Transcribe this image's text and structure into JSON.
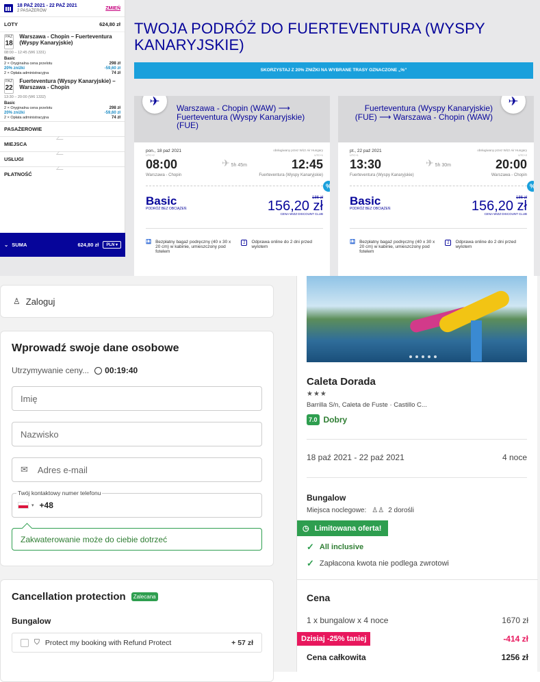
{
  "wizz": {
    "sidebar": {
      "dates": "18 PAŹ 2021 - 22 PAŹ 2021",
      "pax": "2 PASAŻERÓW",
      "change": "ZMIEŃ",
      "flights_label": "LOTY",
      "flights_total": "624,80 zł",
      "outbound": {
        "month": "PAŹ",
        "day": "18",
        "route": "Warszawa - Chopin – Fuerteventura (Wyspy Kanaryjskie)",
        "time": "08:00 – 12:45 (W6 1331)"
      },
      "outbound_fare": {
        "name": "Basic",
        "l1": "2 × Oryginalna cena przelotu",
        "v1": "298 zł",
        "l2": "20% zniżki",
        "v2": "-59,60 zł",
        "l3": "2 × Opłata administracyjna",
        "v3": "74 zł"
      },
      "inbound": {
        "month": "PAŹ",
        "day": "22",
        "route": "Fuerteventura (Wyspy Kanaryjskie) – Warszawa - Chopin",
        "time": "13:30 – 20:00 (W6 1332)"
      },
      "inbound_fare": {
        "name": "Basic",
        "l1": "2 × Oryginalna cena przelotu",
        "v1": "298 zł",
        "l2": "20% zniżki",
        "v2": "-59,60 zł",
        "l3": "2 × Opłata administracyjna",
        "v3": "74 zł"
      },
      "nav": [
        "PASAŻEROWIE",
        "MIEJSCA",
        "USŁUGI",
        "PŁATNOŚĆ"
      ],
      "sum_label": "SUMA",
      "sum_value": "624,80 zł",
      "currency": "PLN"
    },
    "title": "TWOJA PODRÓŻ DO FUERTEVENTURA (WYSPY KANARYJSKIE)",
    "promo": "SKORZYSTAJ Z 20% ZNIŻKI NA WYBRANE TRASY OZNACZONE „%”",
    "cards": [
      {
        "route": "Warszawa - Chopin (WAW) ⟶ Fuerteventura (Wyspy Kanaryjskie) (FUE)",
        "date": "pon., 18 paź 2021",
        "operated": "obsługiwany przez Wizz Air Hungary",
        "utc_l": "UTC+2",
        "utc_r": "UTC+1",
        "dep": "08:00",
        "arr": "12:45",
        "dur": "5h 45m",
        "from": "Warszawa - Chopin",
        "to": "Fuerteventura (Wyspy Kanaryjskie)",
        "fare": "Basic",
        "fare_sub": "PODRÓŻ BEZ OBCIĄŻEŃ",
        "old": "186 zł",
        "price": "156,20 zł",
        "club": "CENA WIZZ DISCOUNT CLUB",
        "perk1": "Bezpłatny bagaż podręczny (40 x 30 x 20 cm) w kabinie, umieszczony pod fotelem",
        "perk2": "Odprawa online do 2 dni przed wylotem",
        "pct": "%"
      },
      {
        "route": "Fuerteventura (Wyspy Kanaryjskie) (FUE) ⟶ Warszawa - Chopin (WAW)",
        "date": "pt., 22 paź 2021",
        "operated": "obsługiwany przez Wizz Air Hungary",
        "utc_l": "UTC+1",
        "utc_r": "UTC+2",
        "dep": "13:30",
        "arr": "20:00",
        "dur": "5h 30m",
        "from": "Fuerteventura (Wyspy Kanaryjskie)",
        "to": "Warszawa - Chopin",
        "fare": "Basic",
        "fare_sub": "PODRÓŻ BEZ OBCIĄŻEŃ",
        "old": "186 zł",
        "price": "156,20 zł",
        "club": "CENA WIZZ DISCOUNT CLUB",
        "perk1": "Bezpłatny bagaż podręczny (40 x 30 x 20 cm) w kabinie, umieszczony pod fotelem",
        "perk2": "Odprawa online do 2 dni przed wylotem",
        "pct": "%"
      }
    ]
  },
  "booking": {
    "login": "Zaloguj",
    "form_title": "Wprowadź swoje dane osobowe",
    "hold_label": "Utrzymywanie ceny...",
    "hold_timer": "00:19:40",
    "first_name_ph": "Imię",
    "last_name_ph": "Nazwisko",
    "email_ph": "Adres e-mail",
    "phone_label": "Twój kontaktowy numer telefonu",
    "phone_prefix": "+48",
    "contact_note": "Zakwaterowanie może do ciebie dotrzeć",
    "cancel_title": "Cancellation protection",
    "cancel_badge": "Zalecana",
    "cancel_room": "Bungalow",
    "protect_label": "Protect my booking with Refund Protect",
    "protect_price": "+ 57 zł",
    "hotel": {
      "name": "Caleta Dorada",
      "stars": "★★★",
      "address": "Barrilla S/n, Caleta de Fuste · Castillo C...",
      "score": "7.0",
      "score_label": "Dobry",
      "dates": "18 paź 2021 - 22 paź 2021",
      "nights": "4 noce",
      "room": "Bungalow",
      "beds_label": "Miejsca noclegowe:",
      "guests": "2 dorośli",
      "limited": "Limitowana oferta!",
      "f1": "All inclusive",
      "f2": "Zapłacona kwota nie podlega zwrotowi"
    },
    "price": {
      "title": "Cena",
      "l1": "1 x bungalow x 4 noce",
      "v1": "1670 zł",
      "disc_label": "Dzisiaj -25% taniej",
      "disc_value": "-414 zł",
      "total_label": "Cena całkowita",
      "total_value": "1256 zł"
    }
  }
}
